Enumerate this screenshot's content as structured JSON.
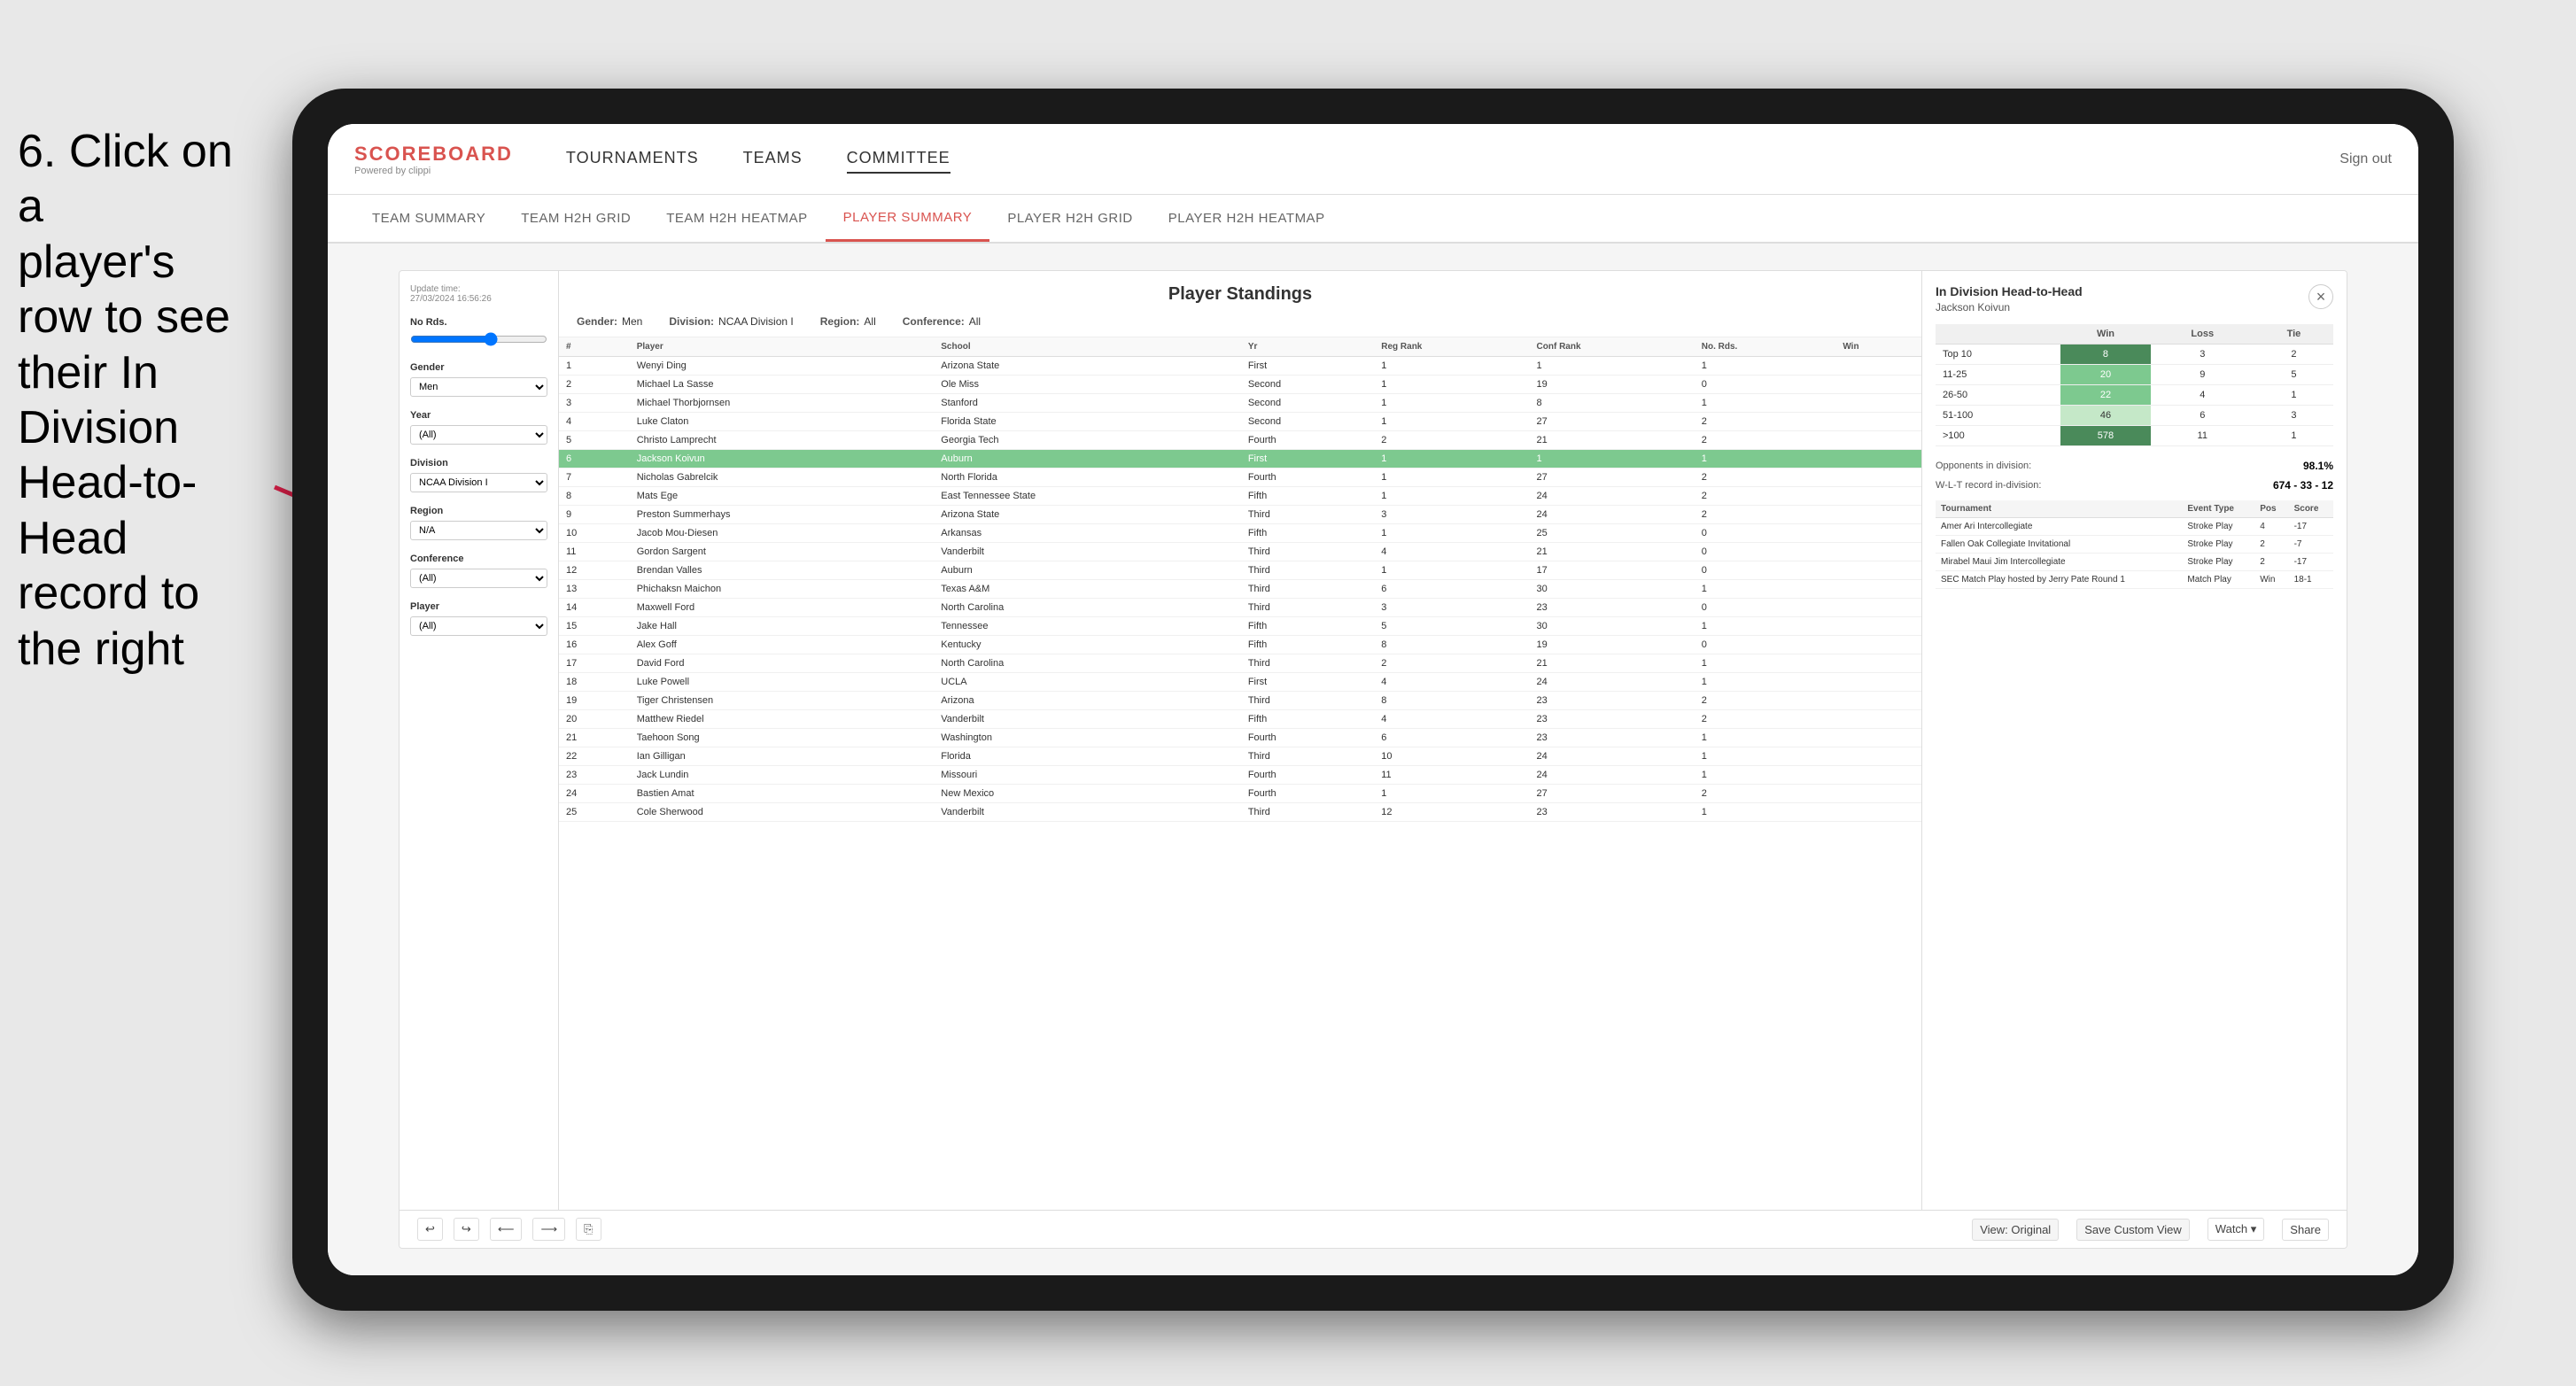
{
  "instruction": {
    "line1": "6. Click on a",
    "line2": "player's row to see",
    "line3": "their In Division",
    "line4": "Head-to-Head",
    "line5": "record to the right"
  },
  "nav": {
    "logo_title": "SCOREBOARD",
    "logo_subtitle": "Powered by clippi",
    "links": [
      "TOURNAMENTS",
      "TEAMS",
      "COMMITTEE"
    ],
    "sign_out": "Sign out"
  },
  "sub_nav": {
    "items": [
      "TEAM SUMMARY",
      "TEAM H2H GRID",
      "TEAM H2H HEATMAP",
      "PLAYER SUMMARY",
      "PLAYER H2H GRID",
      "PLAYER H2H HEATMAP"
    ],
    "active": "PLAYER SUMMARY"
  },
  "filters": {
    "update_time_label": "Update time:",
    "update_time": "27/03/2024 16:56:26",
    "no_rds_label": "No Rds.",
    "gender_label": "Gender",
    "gender_value": "Men",
    "year_label": "Year",
    "year_value": "(All)",
    "division_label": "Division",
    "division_value": "NCAA Division I",
    "region_label": "Region",
    "region_value": "N/A",
    "conference_label": "Conference",
    "conference_value": "(All)",
    "player_label": "Player",
    "player_value": "(All)"
  },
  "standings": {
    "title": "Player Standings",
    "gender_label": "Gender:",
    "gender_value": "Men",
    "division_label": "Division:",
    "division_value": "NCAA Division I",
    "region_label": "Region:",
    "region_value": "All",
    "conference_label": "Conference:",
    "conference_value": "All",
    "columns": [
      "#",
      "Player",
      "School",
      "Yr",
      "Reg Rank",
      "Conf Rank",
      "No. Rds.",
      "Win"
    ],
    "rows": [
      {
        "num": "1",
        "player": "Wenyi Ding",
        "school": "Arizona State",
        "yr": "First",
        "reg": "1",
        "conf": "1",
        "rds": "1",
        "win": ""
      },
      {
        "num": "2",
        "player": "Michael La Sasse",
        "school": "Ole Miss",
        "yr": "Second",
        "reg": "1",
        "conf": "19",
        "rds": "0",
        "win": ""
      },
      {
        "num": "3",
        "player": "Michael Thorbjornsen",
        "school": "Stanford",
        "yr": "Second",
        "reg": "1",
        "conf": "8",
        "rds": "1",
        "win": ""
      },
      {
        "num": "4",
        "player": "Luke Claton",
        "school": "Florida State",
        "yr": "Second",
        "reg": "1",
        "conf": "27",
        "rds": "2",
        "win": ""
      },
      {
        "num": "5",
        "player": "Christo Lamprecht",
        "school": "Georgia Tech",
        "yr": "Fourth",
        "reg": "2",
        "conf": "21",
        "rds": "2",
        "win": ""
      },
      {
        "num": "6",
        "player": "Jackson Koivun",
        "school": "Auburn",
        "yr": "First",
        "reg": "1",
        "conf": "1",
        "rds": "1",
        "win": "",
        "highlighted": true
      },
      {
        "num": "7",
        "player": "Nicholas Gabrelcik",
        "school": "North Florida",
        "yr": "Fourth",
        "reg": "1",
        "conf": "27",
        "rds": "2",
        "win": ""
      },
      {
        "num": "8",
        "player": "Mats Ege",
        "school": "East Tennessee State",
        "yr": "Fifth",
        "reg": "1",
        "conf": "24",
        "rds": "2",
        "win": ""
      },
      {
        "num": "9",
        "player": "Preston Summerhays",
        "school": "Arizona State",
        "yr": "Third",
        "reg": "3",
        "conf": "24",
        "rds": "2",
        "win": ""
      },
      {
        "num": "10",
        "player": "Jacob Mou-Diesen",
        "school": "Arkansas",
        "yr": "Fifth",
        "reg": "1",
        "conf": "25",
        "rds": "0",
        "win": ""
      },
      {
        "num": "11",
        "player": "Gordon Sargent",
        "school": "Vanderbilt",
        "yr": "Third",
        "reg": "4",
        "conf": "21",
        "rds": "0",
        "win": ""
      },
      {
        "num": "12",
        "player": "Brendan Valles",
        "school": "Auburn",
        "yr": "Third",
        "reg": "1",
        "conf": "17",
        "rds": "0",
        "win": ""
      },
      {
        "num": "13",
        "player": "Phichaksn Maichon",
        "school": "Texas A&M",
        "yr": "Third",
        "reg": "6",
        "conf": "30",
        "rds": "1",
        "win": ""
      },
      {
        "num": "14",
        "player": "Maxwell Ford",
        "school": "North Carolina",
        "yr": "Third",
        "reg": "3",
        "conf": "23",
        "rds": "0",
        "win": ""
      },
      {
        "num": "15",
        "player": "Jake Hall",
        "school": "Tennessee",
        "yr": "Fifth",
        "reg": "5",
        "conf": "30",
        "rds": "1",
        "win": ""
      },
      {
        "num": "16",
        "player": "Alex Goff",
        "school": "Kentucky",
        "yr": "Fifth",
        "reg": "8",
        "conf": "19",
        "rds": "0",
        "win": ""
      },
      {
        "num": "17",
        "player": "David Ford",
        "school": "North Carolina",
        "yr": "Third",
        "reg": "2",
        "conf": "21",
        "rds": "1",
        "win": ""
      },
      {
        "num": "18",
        "player": "Luke Powell",
        "school": "UCLA",
        "yr": "First",
        "reg": "4",
        "conf": "24",
        "rds": "1",
        "win": ""
      },
      {
        "num": "19",
        "player": "Tiger Christensen",
        "school": "Arizona",
        "yr": "Third",
        "reg": "8",
        "conf": "23",
        "rds": "2",
        "win": ""
      },
      {
        "num": "20",
        "player": "Matthew Riedel",
        "school": "Vanderbilt",
        "yr": "Fifth",
        "reg": "4",
        "conf": "23",
        "rds": "2",
        "win": ""
      },
      {
        "num": "21",
        "player": "Taehoon Song",
        "school": "Washington",
        "yr": "Fourth",
        "reg": "6",
        "conf": "23",
        "rds": "1",
        "win": ""
      },
      {
        "num": "22",
        "player": "Ian Gilligan",
        "school": "Florida",
        "yr": "Third",
        "reg": "10",
        "conf": "24",
        "rds": "1",
        "win": ""
      },
      {
        "num": "23",
        "player": "Jack Lundin",
        "school": "Missouri",
        "yr": "Fourth",
        "reg": "11",
        "conf": "24",
        "rds": "1",
        "win": ""
      },
      {
        "num": "24",
        "player": "Bastien Amat",
        "school": "New Mexico",
        "yr": "Fourth",
        "reg": "1",
        "conf": "27",
        "rds": "2",
        "win": ""
      },
      {
        "num": "25",
        "player": "Cole Sherwood",
        "school": "Vanderbilt",
        "yr": "Third",
        "reg": "12",
        "conf": "23",
        "rds": "1",
        "win": ""
      }
    ]
  },
  "h2h": {
    "title": "In Division Head-to-Head",
    "player_name": "Jackson Koivun",
    "close_label": "×",
    "categories": [
      "Top 10",
      "11-25",
      "26-50",
      "51-100",
      ">100"
    ],
    "table_headers": [
      "",
      "Win",
      "Loss",
      "Tie"
    ],
    "rows": [
      {
        "cat": "Top 10",
        "win": "8",
        "loss": "3",
        "tie": "2",
        "win_style": "dark"
      },
      {
        "cat": "11-25",
        "win": "20",
        "loss": "9",
        "tie": "5",
        "win_style": "medium"
      },
      {
        "cat": "26-50",
        "win": "22",
        "loss": "4",
        "tie": "1",
        "win_style": "medium"
      },
      {
        "cat": "51-100",
        "win": "46",
        "loss": "6",
        "tie": "3",
        "win_style": "light"
      },
      {
        "cat": ">100",
        "win": "578",
        "loss": "11",
        "tie": "1",
        "win_style": "dark"
      }
    ],
    "opponents_label": "Opponents in division:",
    "opponents_value": "98.1%",
    "wlt_label": "W-L-T record in-division:",
    "wlt_value": "674 - 33 - 12",
    "tournament_headers": [
      "Tournament",
      "Event Type",
      "Pos",
      "Score"
    ],
    "tournaments": [
      {
        "name": "Amer Ari Intercollegiate",
        "type": "Stroke Play",
        "pos": "4",
        "score": "-17"
      },
      {
        "name": "Fallen Oak Collegiate Invitational",
        "type": "Stroke Play",
        "pos": "2",
        "score": "-7"
      },
      {
        "name": "Mirabel Maui Jim Intercollegiate",
        "type": "Stroke Play",
        "pos": "2",
        "score": "-17"
      },
      {
        "name": "SEC Match Play hosted by Jerry Pate Round 1",
        "type": "Match Play",
        "pos": "Win",
        "score": "18-1"
      }
    ]
  },
  "bottom_toolbar": {
    "undo": "↩",
    "redo": "↪",
    "forward": "⟶",
    "back": "⟵",
    "copy": "⎘",
    "paste": "⎘",
    "view_original": "View: Original",
    "save_custom": "Save Custom View",
    "watch": "Watch ▾",
    "share": "Share"
  }
}
